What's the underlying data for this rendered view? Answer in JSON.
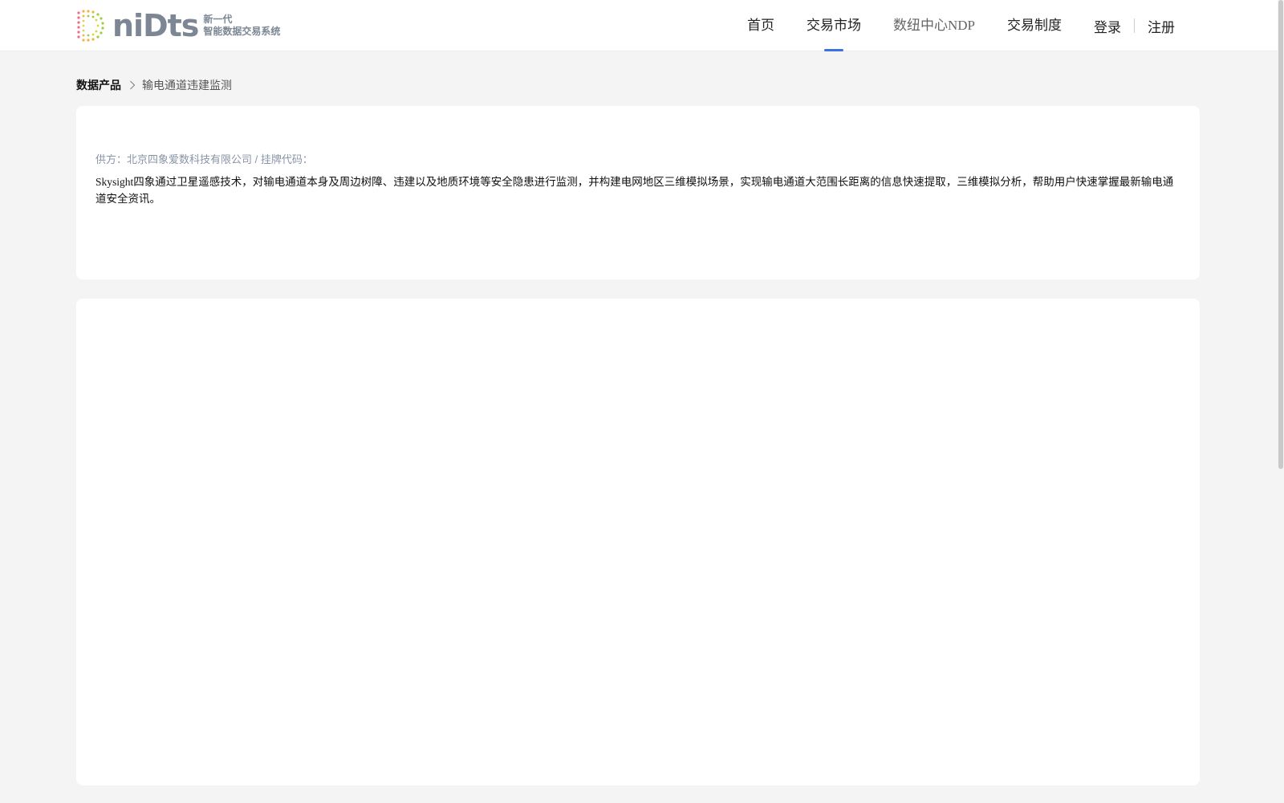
{
  "brand": {
    "name": "niDts",
    "tagline_top": "新一代",
    "tagline_bottom": "智能数据交易系统",
    "colors": {
      "logo_text": "#7c8694",
      "accent": "#3a73e0"
    }
  },
  "nav": {
    "home": "首页",
    "market": "交易市场",
    "ndp": "数纽中心NDP",
    "rules": "交易制度",
    "login": "登录",
    "register": "注册",
    "active": "交易市场"
  },
  "breadcrumb": {
    "root": "数据产品",
    "separator_icon": "chevron-right-icon",
    "current": "输电通道违建监测"
  },
  "product": {
    "supplier": "供方：北京四象爱数科技有限公司 / 挂牌代码：",
    "description": "Skysight四象通过卫星遥感技术，对输电通道本身及周边树障、违建以及地质环境等安全隐患进行监测，并构建电网地区三维模拟场景，实现输电通道大范围长距离的信息快速提取，三维模拟分析，帮助用户快速掌握最新输电通道安全资讯。"
  }
}
